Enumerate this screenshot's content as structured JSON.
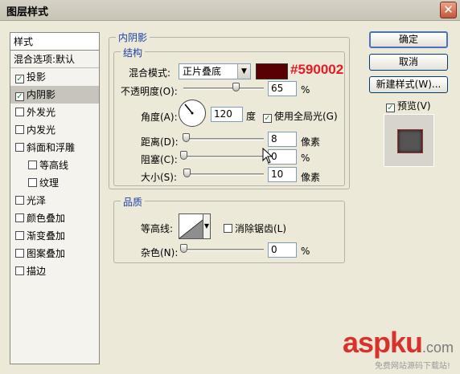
{
  "window": {
    "title": "图层样式",
    "close_label": "✕"
  },
  "style_list": {
    "header": "样式",
    "blend_item": "混合选项:默认",
    "items": [
      {
        "label": "投影",
        "checked": true,
        "indent": false,
        "active": false
      },
      {
        "label": "内阴影",
        "checked": true,
        "indent": false,
        "active": true
      },
      {
        "label": "外发光",
        "checked": false,
        "indent": false,
        "active": false
      },
      {
        "label": "内发光",
        "checked": false,
        "indent": false,
        "active": false
      },
      {
        "label": "斜面和浮雕",
        "checked": false,
        "indent": false,
        "active": false
      },
      {
        "label": "等高线",
        "checked": false,
        "indent": true,
        "active": false
      },
      {
        "label": "纹理",
        "checked": false,
        "indent": true,
        "active": false
      },
      {
        "label": "光泽",
        "checked": false,
        "indent": false,
        "active": false
      },
      {
        "label": "颜色叠加",
        "checked": false,
        "indent": false,
        "active": false
      },
      {
        "label": "渐变叠加",
        "checked": false,
        "indent": false,
        "active": false
      },
      {
        "label": "图案叠加",
        "checked": false,
        "indent": false,
        "active": false
      },
      {
        "label": "描边",
        "checked": false,
        "indent": false,
        "active": false
      }
    ]
  },
  "inner_shadow": {
    "section_title": "内阴影",
    "structure": {
      "title": "结构",
      "blend_mode_label": "混合模式:",
      "blend_mode_value": "正片叠底",
      "color_hex_label": "#590002",
      "color": "#590002",
      "opacity_label": "不透明度(O):",
      "opacity_value": "65",
      "opacity_unit": "%",
      "opacity_fraction": 0.65,
      "angle_label": "角度(A):",
      "angle_value": "120",
      "angle_unit": "度",
      "global_light_label": "使用全局光(G)",
      "global_light_checked": true,
      "distance_label": "距离(D):",
      "distance_value": "8",
      "distance_unit": "像素",
      "distance_fraction": 0.03,
      "choke_label": "阻塞(C):",
      "choke_value": "0",
      "choke_unit": "%",
      "choke_fraction": 0.0,
      "size_label": "大小(S):",
      "size_value": "10",
      "size_unit": "像素",
      "size_fraction": 0.04
    },
    "quality": {
      "title": "品质",
      "contour_label": "等高线:",
      "anti_alias_label": "消除锯齿(L)",
      "anti_alias_checked": false,
      "noise_label": "杂色(N):",
      "noise_value": "0",
      "noise_unit": "%",
      "noise_fraction": 0.0
    }
  },
  "buttons": {
    "ok": "确定",
    "cancel": "取消",
    "new_style": "新建样式(W)...",
    "preview_label": "预览(V)",
    "preview_checked": true
  },
  "watermark": {
    "main": "aspku",
    "suffix": ".com",
    "sub": "免费网站源码下载站!"
  },
  "colors": {
    "accent": "#1c3ea3",
    "shadow_color": "#590002",
    "hex_text": "#e51a23"
  }
}
